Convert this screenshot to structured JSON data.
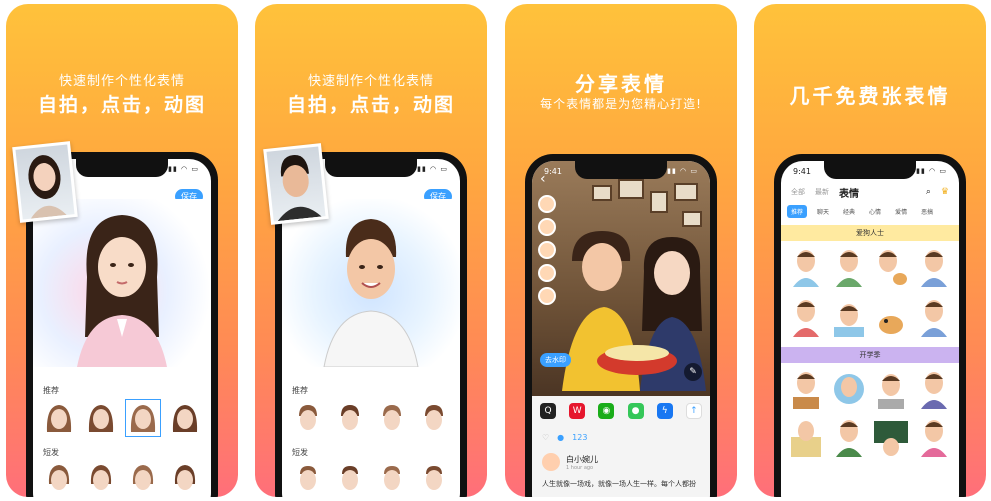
{
  "cards": [
    {
      "headline_small": "快速制作个性化表情",
      "headline_big": "自拍，点击，动图",
      "screen": {
        "time": "",
        "save_label": "保存",
        "sections": [
          {
            "label": "推荐"
          },
          {
            "label": "短发"
          }
        ]
      }
    },
    {
      "headline_small": "快速制作个性化表情",
      "headline_big": "自拍，点击，动图",
      "screen": {
        "save_label": "保存",
        "sections": [
          {
            "label": "推荐"
          },
          {
            "label": "短发"
          }
        ]
      }
    },
    {
      "headline_big": "分享表情",
      "headline_small": "每个表情都是为您精心打造!",
      "screen": {
        "time": "9:41",
        "tag_label": "去水印",
        "like_count": "123",
        "user_name": "白小婉儿",
        "user_sub": "1 hour ago",
        "post_text": "人生就像一场戏，就像一场人生一样。每个人都扮"
      }
    },
    {
      "headline_big": "几千免费张表情",
      "screen": {
        "time": "9:41",
        "nav": [
          "全部",
          "最新",
          "表情"
        ],
        "categories": [
          "推荐",
          "聊天",
          "经典",
          "心情",
          "爱情",
          "恶搞"
        ],
        "band1": "爱狗人士",
        "band2": "开学季"
      }
    }
  ],
  "colors": {
    "card_top": "#ffc23b",
    "card_bottom": "#ff6f7a",
    "accent_blue": "#3aa0ff"
  }
}
